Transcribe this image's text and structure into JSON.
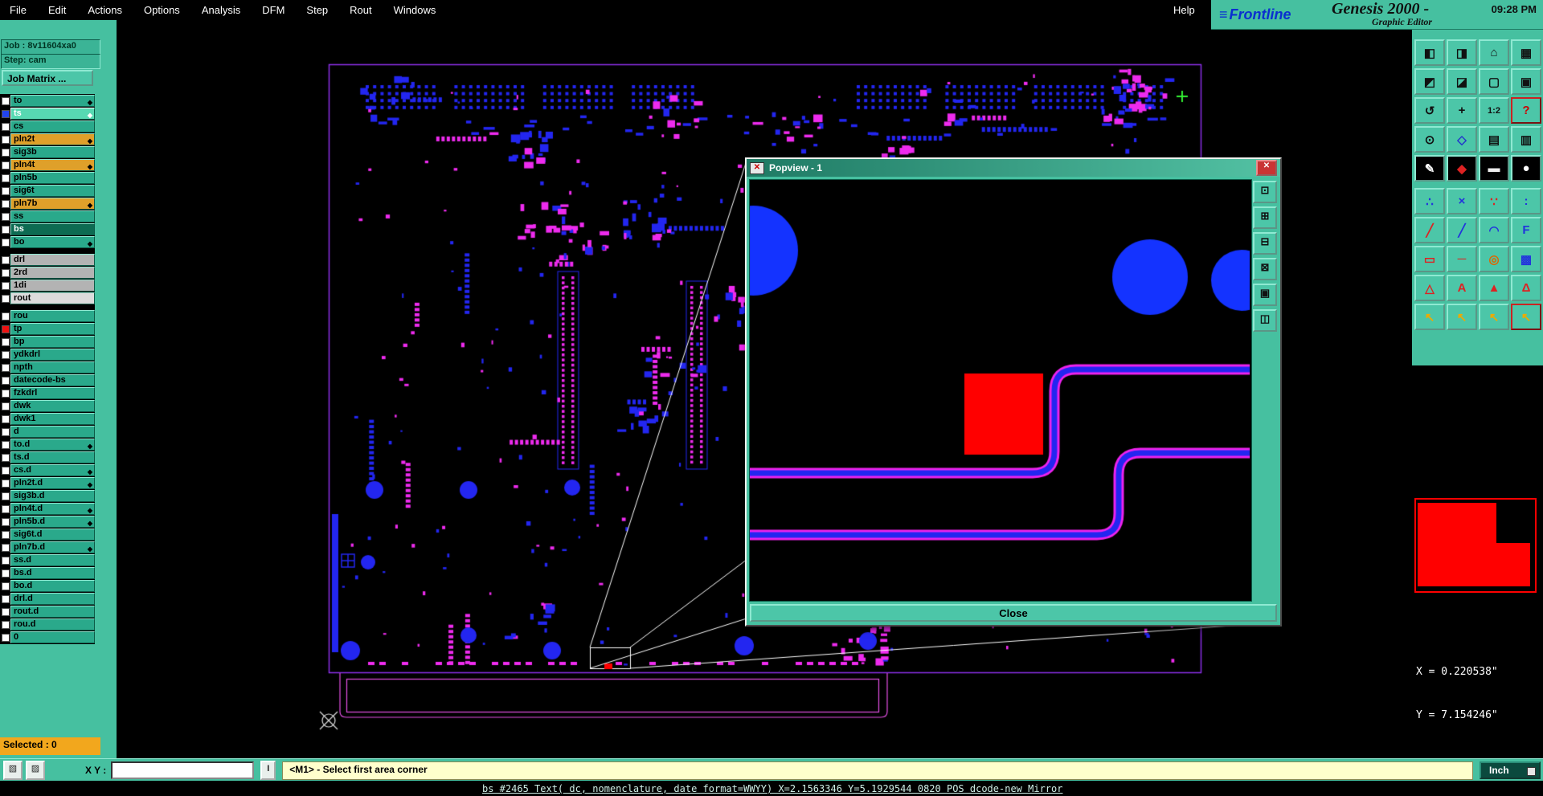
{
  "menu": {
    "items": [
      "File",
      "Edit",
      "Actions",
      "Options",
      "Analysis",
      "DFM",
      "Step",
      "Rout",
      "Windows"
    ],
    "help": "Help"
  },
  "branding": {
    "logo": "Frontline",
    "product": "Genesis 2000 -",
    "subtitle": "Graphic Editor",
    "time": "09:28 PM"
  },
  "left_panel": {
    "job_label": "Job : 8v11604xa0",
    "step_label": "Step: cam",
    "job_matrix_button": "Job Matrix ...",
    "selected_label": "Selected : 0",
    "layers": [
      {
        "label": "to",
        "style": "teal",
        "marker": true
      },
      {
        "label": "ts",
        "style": "selected",
        "marker": true,
        "chip": "#2244ee"
      },
      {
        "label": "cs",
        "style": "teal",
        "marker": false
      },
      {
        "label": "pln2t",
        "style": "orange",
        "marker": true
      },
      {
        "label": "sig3b",
        "style": "teal",
        "marker": false
      },
      {
        "label": "pln4t",
        "style": "orange",
        "marker": true
      },
      {
        "label": "pln5b",
        "style": "teal",
        "marker": false
      },
      {
        "label": "sig6t",
        "style": "teal",
        "marker": false
      },
      {
        "label": "pln7b",
        "style": "orange",
        "marker": true
      },
      {
        "label": "ss",
        "style": "teal",
        "marker": false
      },
      {
        "label": "bs",
        "style": "dark",
        "marker": false
      },
      {
        "label": "bo",
        "style": "teal",
        "marker": true,
        "gap_after": true
      },
      {
        "label": "drl",
        "style": "gray",
        "marker": false
      },
      {
        "label": "2rd",
        "style": "gray",
        "marker": false
      },
      {
        "label": "1di",
        "style": "gray",
        "marker": false
      },
      {
        "label": "rout",
        "style": "light",
        "marker": false,
        "gap_after": true
      },
      {
        "label": "rou",
        "style": "teal",
        "marker": false
      },
      {
        "label": "tp",
        "style": "teal",
        "marker": false,
        "chip": "#ee1111"
      },
      {
        "label": "bp",
        "style": "teal",
        "marker": false
      },
      {
        "label": "ydkdrl",
        "style": "teal",
        "marker": false
      },
      {
        "label": "npth",
        "style": "teal",
        "marker": false
      },
      {
        "label": "datecode-bs",
        "style": "teal",
        "marker": false
      },
      {
        "label": "fzkdrl",
        "style": "teal",
        "marker": false
      },
      {
        "label": "dwk",
        "style": "teal",
        "marker": false
      },
      {
        "label": "dwk1",
        "style": "teal",
        "marker": false
      },
      {
        "label": "d",
        "style": "teal",
        "marker": false
      },
      {
        "label": "to.d",
        "style": "teal",
        "marker": true
      },
      {
        "label": "ts.d",
        "style": "teal",
        "marker": false
      },
      {
        "label": "cs.d",
        "style": "teal",
        "marker": true
      },
      {
        "label": "pln2t.d",
        "style": "teal",
        "marker": true
      },
      {
        "label": "sig3b.d",
        "style": "teal",
        "marker": false
      },
      {
        "label": "pln4t.d",
        "style": "teal",
        "marker": true
      },
      {
        "label": "pln5b.d",
        "style": "teal",
        "marker": true
      },
      {
        "label": "sig6t.d",
        "style": "teal",
        "marker": false
      },
      {
        "label": "pln7b.d",
        "style": "teal",
        "marker": true
      },
      {
        "label": "ss.d",
        "style": "teal",
        "marker": false
      },
      {
        "label": "bs.d",
        "style": "teal",
        "marker": false
      },
      {
        "label": "bo.d",
        "style": "teal",
        "marker": false
      },
      {
        "label": "drl.d",
        "style": "teal",
        "marker": false
      },
      {
        "label": "rout.d",
        "style": "teal",
        "marker": false
      },
      {
        "label": "rou.d",
        "style": "teal",
        "marker": false
      },
      {
        "label": "0",
        "style": "teal",
        "marker": false
      }
    ]
  },
  "toolbar": {
    "icons": [
      {
        "name": "window-half-left-icon",
        "glyph": "◧"
      },
      {
        "name": "window-half-right-icon",
        "glyph": "◨"
      },
      {
        "name": "home-view-icon",
        "glyph": "⌂"
      },
      {
        "name": "grid-view-icon",
        "glyph": "▦"
      },
      {
        "name": "window-corner-icon",
        "glyph": "◩"
      },
      {
        "name": "window-corner-2-icon",
        "glyph": "◪"
      },
      {
        "name": "empty-frame-icon",
        "glyph": "▢"
      },
      {
        "name": "filled-frame-icon",
        "glyph": "▣"
      },
      {
        "name": "rotate-view-icon",
        "glyph": "↺"
      },
      {
        "name": "pan-view-icon",
        "glyph": "+"
      },
      {
        "name": "zoom-1-2-icon",
        "glyph": "1:2"
      },
      {
        "name": "help-mode-icon",
        "glyph": "?",
        "color": "#cc0000",
        "frame": "#cc2222"
      },
      {
        "name": "clock-tool-icon",
        "glyph": "⊙"
      },
      {
        "name": "diamond-tool-icon",
        "glyph": "◇",
        "color": "#2233cc"
      },
      {
        "name": "layers-table-icon",
        "glyph": "▤"
      },
      {
        "name": "rows-table-icon",
        "glyph": "▥"
      },
      {
        "name": "pen-tool-icon",
        "glyph": "✎",
        "bg": "#000000",
        "color": "#ffffff"
      },
      {
        "name": "palette-tool-icon",
        "glyph": "◆",
        "bg": "#000000",
        "color": "#dd2222"
      },
      {
        "name": "ruler-tool-icon",
        "glyph": "▬",
        "bg": "#000000",
        "color": "#eeeeee"
      },
      {
        "name": "dot-tool-icon",
        "glyph": "●",
        "bg": "#000000",
        "color": "#ffffff"
      },
      {
        "name": "net-points-icon",
        "glyph": "∴",
        "color": "#2233dd"
      },
      {
        "name": "net-delete-icon",
        "glyph": "×",
        "color": "#2233dd"
      },
      {
        "name": "pad-pair-icon",
        "glyph": "∵",
        "color": "#dd2222"
      },
      {
        "name": "dot-pair-icon",
        "glyph": ":",
        "color": "#2233dd"
      },
      {
        "name": "line-red-icon",
        "glyph": "╱",
        "color": "#dd2222"
      },
      {
        "name": "line-blue-icon",
        "glyph": "╱",
        "color": "#2233dd"
      },
      {
        "name": "arc-tool-icon",
        "glyph": "◠",
        "color": "#2233dd"
      },
      {
        "name": "text-tool-icon",
        "glyph": "F",
        "color": "#2233dd"
      },
      {
        "name": "rect-red-icon",
        "glyph": "▭",
        "color": "#dd2222"
      },
      {
        "name": "dash-red-icon",
        "glyph": "─",
        "color": "#dd2222"
      },
      {
        "name": "target-tool-icon",
        "glyph": "◎",
        "color": "#dd6600"
      },
      {
        "name": "grid-blue-icon",
        "glyph": "▩",
        "color": "#2233dd"
      },
      {
        "name": "triangle-outline-icon",
        "glyph": "△",
        "color": "#dd2222"
      },
      {
        "name": "letter-a-icon",
        "glyph": "A",
        "color": "#dd2222"
      },
      {
        "name": "triangle-filled-icon",
        "glyph": "▲",
        "color": "#dd2222"
      },
      {
        "name": "delta-icon",
        "glyph": "Δ",
        "color": "#dd2222"
      },
      {
        "name": "cursor-select-icon",
        "glyph": "↖",
        "color": "#eeaa00"
      },
      {
        "name": "cursor-select-2-icon",
        "glyph": "↖",
        "color": "#eeaa00"
      },
      {
        "name": "cursor-select-3-icon",
        "glyph": "↖",
        "color": "#eeaa00"
      },
      {
        "name": "cursor-grid-icon",
        "glyph": "↖",
        "color": "#eeaa00",
        "frame": "#cc2222"
      }
    ]
  },
  "popview": {
    "title": "Popview - 1",
    "close_x": "✕",
    "close_button": "Close",
    "tools": [
      {
        "name": "zoom-window-icon",
        "glyph": "⊡"
      },
      {
        "name": "zoom-in-icon",
        "glyph": "⊞"
      },
      {
        "name": "zoom-out-icon",
        "glyph": "⊟"
      },
      {
        "name": "pan-icon",
        "glyph": "⊠"
      },
      {
        "name": "fit-view-icon",
        "glyph": "▣"
      },
      {
        "name": "layers-view-icon",
        "glyph": "◫"
      }
    ]
  },
  "right_panel": {
    "x": "X = 0.220538\"",
    "y": "Y = 7.154246\""
  },
  "statusbar": {
    "tool1_glyph": "▧",
    "tool2_glyph": "▨",
    "xy_label": "X Y :",
    "input_value": "",
    "marker_glyph": "I",
    "message": "<M1> - Select first area corner",
    "units": "Inch"
  },
  "bottom_status": "bs #2465 Text( dc, nomenclature, date format=WWYY) X=2.1563346 Y=5.1929544 0820 POS dcode-new Mirror"
}
